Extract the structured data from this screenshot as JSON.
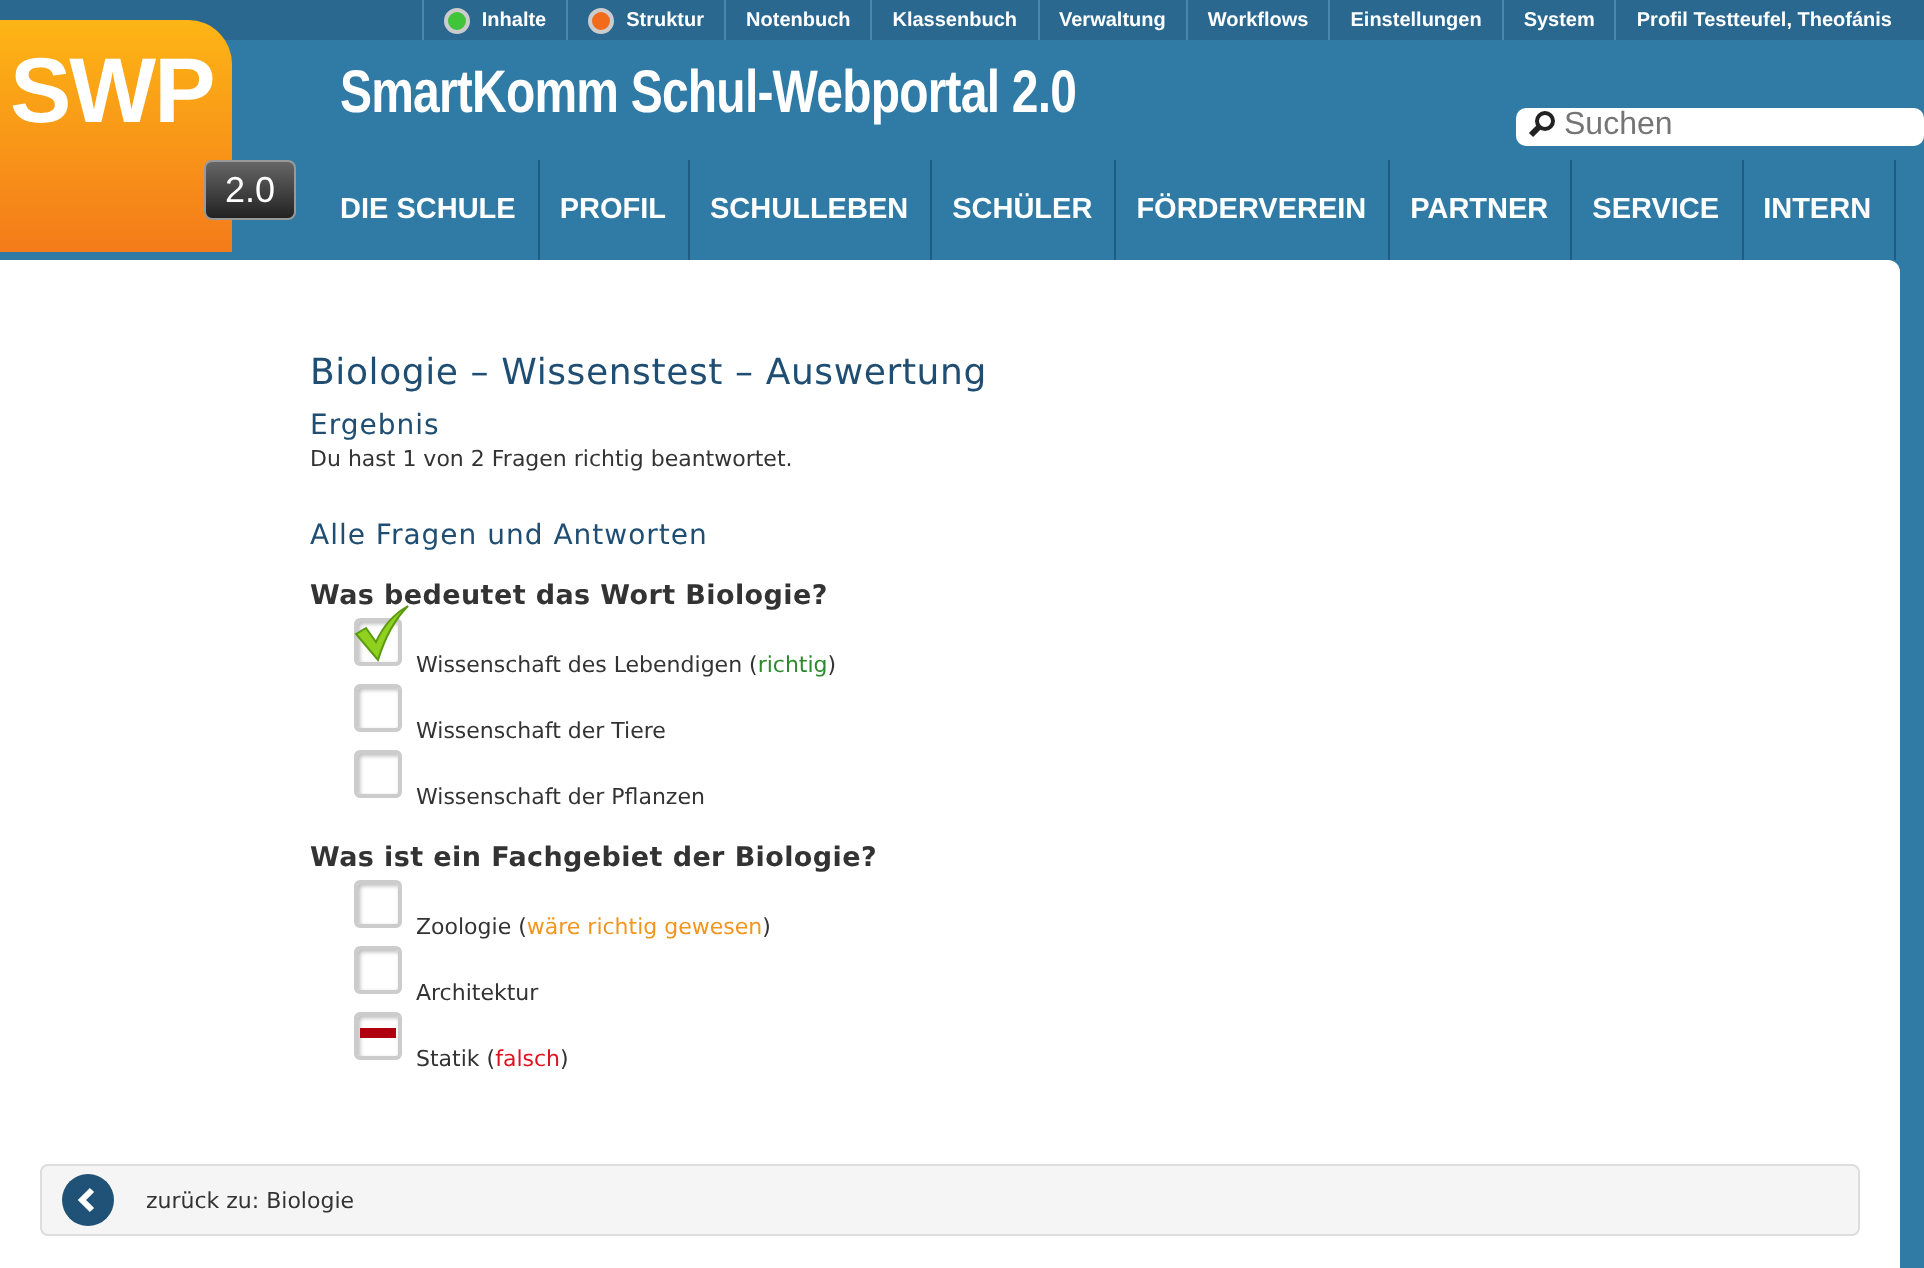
{
  "top_menu": [
    {
      "label": "Inhalte",
      "color": "#3fc43a"
    },
    {
      "label": "Struktur",
      "color": "#f26b1d"
    },
    {
      "label": "Notenbuch"
    },
    {
      "label": "Klassenbuch"
    },
    {
      "label": "Verwaltung"
    },
    {
      "label": "Workflows"
    },
    {
      "label": "Einstellungen"
    },
    {
      "label": "System"
    },
    {
      "label": "Profil Testteufel, Theofánis"
    }
  ],
  "logo": {
    "text": "SWP",
    "version": "2.0"
  },
  "site_title": "SmartKomm Schul-Webportal 2.0",
  "search": {
    "placeholder": "Suchen"
  },
  "main_nav": [
    {
      "label": "DIE SCHULE"
    },
    {
      "label": "PROFIL"
    },
    {
      "label": "SCHULLEBEN"
    },
    {
      "label": "SCHÜLER"
    },
    {
      "label": "FÖRDERVEREIN"
    },
    {
      "label": "PARTNER"
    },
    {
      "label": "SERVICE"
    },
    {
      "label": "INTERN"
    }
  ],
  "page_title": "Biologie – Wissenstest – Auswertung",
  "result": {
    "heading": "Ergebnis",
    "text": "Du hast 1 von 2 Fragen richtig beantwortet."
  },
  "all_heading": "Alle Fragen und Antworten",
  "questions": [
    {
      "question": "Was bedeutet das Wort Biologie?",
      "answers": [
        {
          "text": "Wissenschaft des Lebendigen (",
          "note": "richtig",
          "note_end": ")",
          "color": "#2b8a2b",
          "kind": "correct",
          "checked": true
        },
        {
          "text": "Wissenschaft der Tiere",
          "checked": false
        },
        {
          "text": "Wissenschaft der Pflanzen",
          "checked": false
        }
      ]
    },
    {
      "question": "Was ist ein Fachgebiet der Biologie?",
      "answers": [
        {
          "text": "Zoologie (",
          "note": "wäre richtig gewesen",
          "note_end": ")",
          "color": "#f0961e",
          "checked": false
        },
        {
          "text": "Architektur",
          "checked": false
        },
        {
          "text": "Statik (",
          "note": "falsch",
          "note_end": ")",
          "color": "#e0101e",
          "kind": "wrong",
          "checked": true
        }
      ]
    }
  ],
  "back_link": {
    "label": "zurück zu: Biologie"
  }
}
